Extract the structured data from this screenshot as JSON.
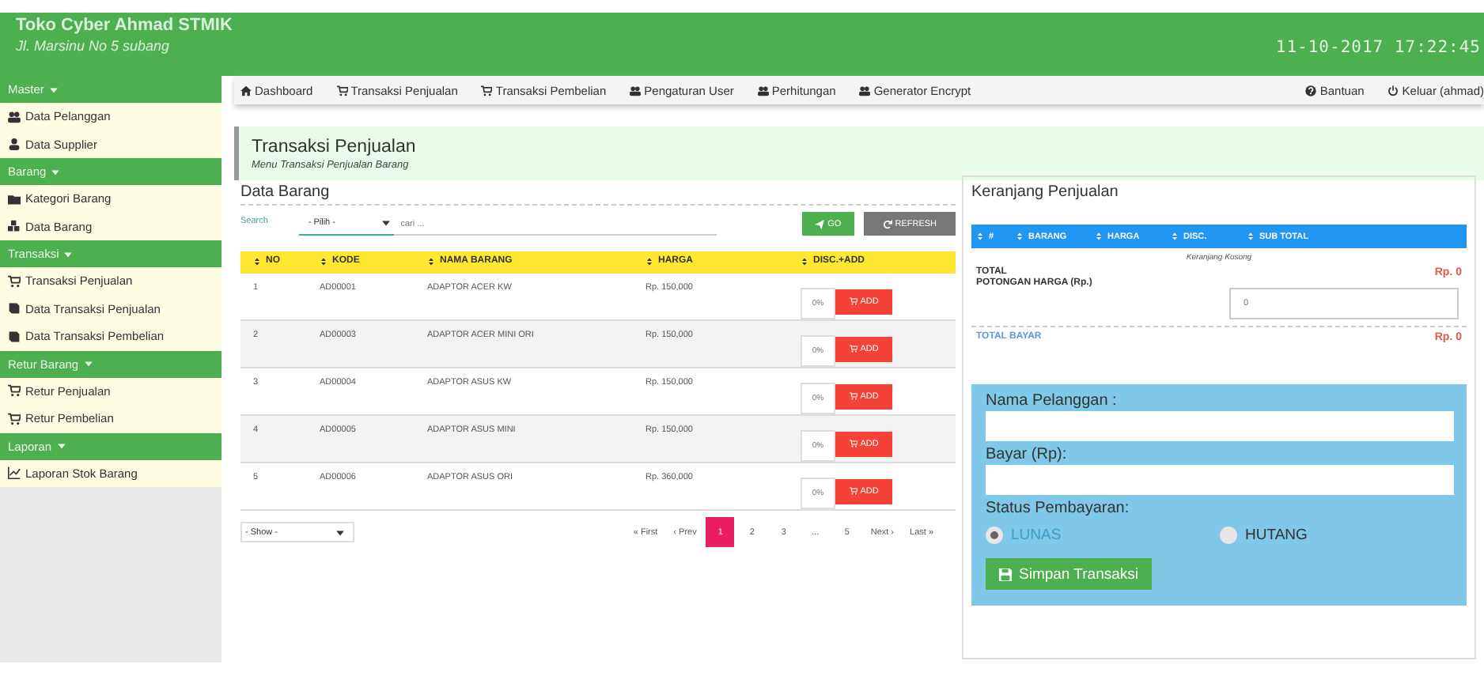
{
  "header": {
    "title": "Toko Cyber Ahmad STMIK",
    "subtitle": "Jl. Marsinu No 5 subang",
    "datetime": "11-10-2017 17:22:45"
  },
  "sidebar": [
    {
      "label": "Master",
      "items": [
        "Data Pelanggan",
        "Data Supplier"
      ]
    },
    {
      "label": "Barang",
      "items": [
        "Kategori Barang",
        "Data Barang"
      ]
    },
    {
      "label": "Transaksi",
      "items": [
        "Transaksi Penjualan",
        "Data Transaksi Penjualan",
        "Data Transaksi Pembelian"
      ]
    },
    {
      "label": "Retur Barang",
      "items": [
        "Retur Penjualan",
        "Retur Pembelian"
      ]
    },
    {
      "label": "Laporan",
      "items": [
        "Laporan Stok Barang"
      ]
    }
  ],
  "nav": {
    "left": [
      "Dashboard",
      "Transaksi Penjualan",
      "Transaksi Pembelian",
      "Pengaturan User",
      "Perhitungan",
      "Generator Encrypt"
    ],
    "right": [
      "Bantuan",
      "Keluar (ahmad)"
    ]
  },
  "page": {
    "title": "Transaksi Penjualan",
    "subtitle": "Menu Transaksi Penjualan Barang"
  },
  "data_barang": {
    "title": "Data Barang",
    "search_label": "Search",
    "filter": "- Pilih -",
    "placeholder": "cari ...",
    "go": "GO",
    "refresh": "REFRESH",
    "columns": [
      "NO",
      "KODE",
      "NAMA BARANG",
      "HARGA",
      "DISC.+ADD"
    ],
    "rows": [
      {
        "no": "1",
        "kode": "AD00001",
        "nama": "ADAPTOR ACER KW",
        "harga": "Rp. 150,000",
        "disc": "0%",
        "add": "ADD"
      },
      {
        "no": "2",
        "kode": "AD00003",
        "nama": "ADAPTOR ACER MINI ORI",
        "harga": "Rp. 150,000",
        "disc": "0%",
        "add": "ADD"
      },
      {
        "no": "3",
        "kode": "AD00004",
        "nama": "ADAPTOR ASUS KW",
        "harga": "Rp. 150,000",
        "disc": "0%",
        "add": "ADD"
      },
      {
        "no": "4",
        "kode": "AD00005",
        "nama": "ADAPTOR ASUS MINI",
        "harga": "Rp. 150,000",
        "disc": "0%",
        "add": "ADD"
      },
      {
        "no": "5",
        "kode": "AD00006",
        "nama": "ADAPTOR ASUS ORI",
        "harga": "Rp. 360,000",
        "disc": "0%",
        "add": "ADD"
      }
    ],
    "show": "- Show -",
    "pagination": [
      {
        "label": "« First",
        "selected": false
      },
      {
        "label": "‹ Prev",
        "selected": false
      },
      {
        "label": "1",
        "selected": true
      },
      {
        "label": "2",
        "selected": false
      },
      {
        "label": "3",
        "selected": false
      },
      {
        "label": "...",
        "selected": false
      },
      {
        "label": "5",
        "selected": false
      },
      {
        "label": "Next ›",
        "selected": false
      },
      {
        "label": "Last »",
        "selected": false
      }
    ]
  },
  "cart": {
    "title": "Keranjang Penjualan",
    "columns": [
      "#",
      "BARANG",
      "HARGA",
      "DISC.",
      "SUB TOTAL"
    ],
    "empty": "Keranjang Kosong",
    "total_label": "TOTAL",
    "total_value": "Rp. 0",
    "discount_label": "POTONGAN HARGA (Rp.)",
    "discount_value": "0",
    "pay_label": "TOTAL BAYAR",
    "pay_value": "Rp. 0"
  },
  "form": {
    "customer_label": "Nama Pelanggan :",
    "pay_label": "Bayar (Rp):",
    "status_label": "Status Pembayaran:",
    "status_options": [
      {
        "label": "LUNAS",
        "selected": true
      },
      {
        "label": "HUTANG",
        "selected": false
      }
    ],
    "save": "Simpan Transaksi"
  }
}
